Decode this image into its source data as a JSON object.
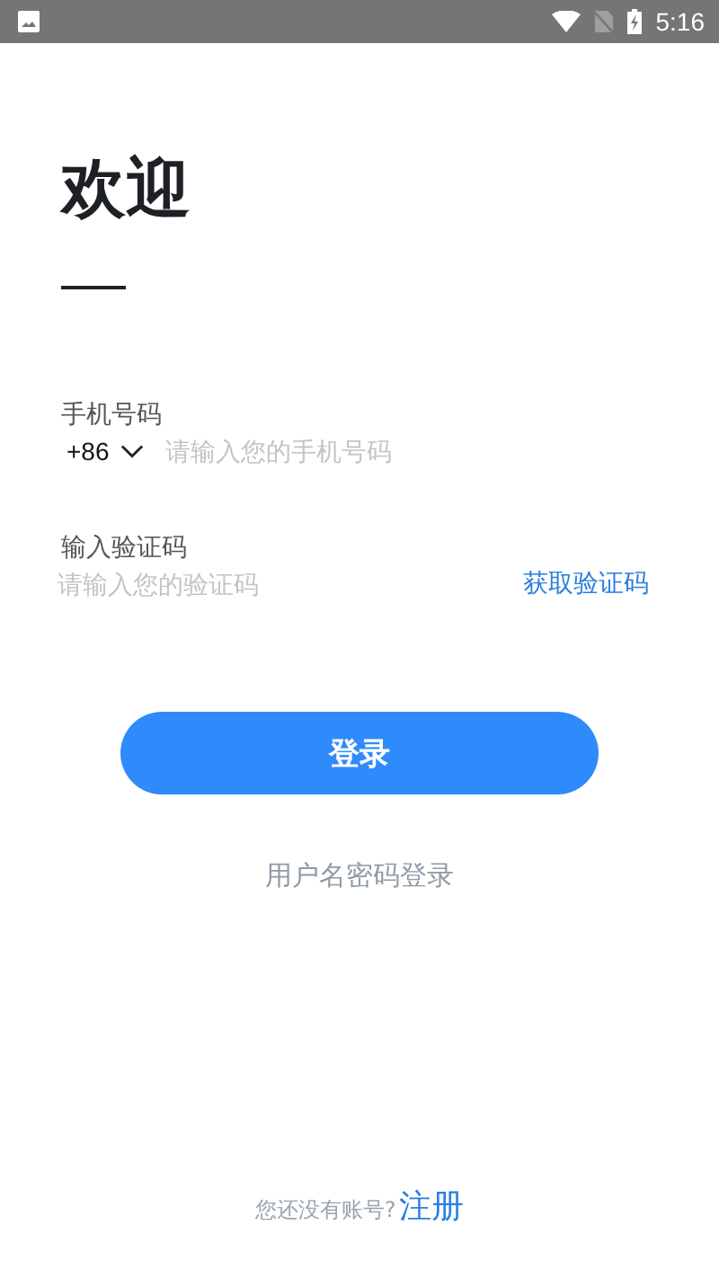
{
  "status_bar": {
    "time": "5:16"
  },
  "title": "欢迎",
  "phone": {
    "label": "手机号码",
    "country_code": "+86",
    "placeholder": "请输入您的手机号码"
  },
  "code": {
    "label": "输入验证码",
    "placeholder": "请输入您的验证码",
    "get_code": "获取验证码"
  },
  "login_button": "登录",
  "alt_login": "用户名密码登录",
  "footer": {
    "prompt": "您还没有账号?",
    "register": "注册"
  }
}
